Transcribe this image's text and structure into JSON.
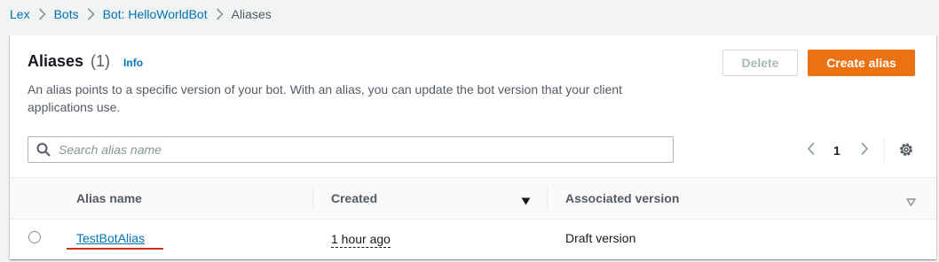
{
  "breadcrumb": {
    "items": [
      "Lex",
      "Bots",
      "Bot: HelloWorldBot"
    ],
    "current": "Aliases"
  },
  "header": {
    "title": "Aliases",
    "count": "(1)",
    "info_label": "Info",
    "description": "An alias points to a specific version of your bot. With an alias, you can update the bot version that your client applications use."
  },
  "actions": {
    "delete_label": "Delete",
    "create_label": "Create alias"
  },
  "search": {
    "placeholder": "Search alias name",
    "value": ""
  },
  "pagination": {
    "current_page": "1"
  },
  "table": {
    "columns": [
      "Alias name",
      "Created",
      "Associated version"
    ],
    "rows": [
      {
        "alias_name": "TestBotAlias",
        "created": "1 hour ago",
        "associated_version": "Draft version",
        "selected": false
      }
    ]
  },
  "colors": {
    "link": "#0073bb",
    "primary_button": "#ec7211",
    "annotation_underline": "#d13212",
    "background": "#f2f3f3"
  },
  "icons": [
    "chevron-right-icon",
    "search-icon",
    "chevron-left-icon",
    "gear-icon",
    "caret-down-icon"
  ]
}
